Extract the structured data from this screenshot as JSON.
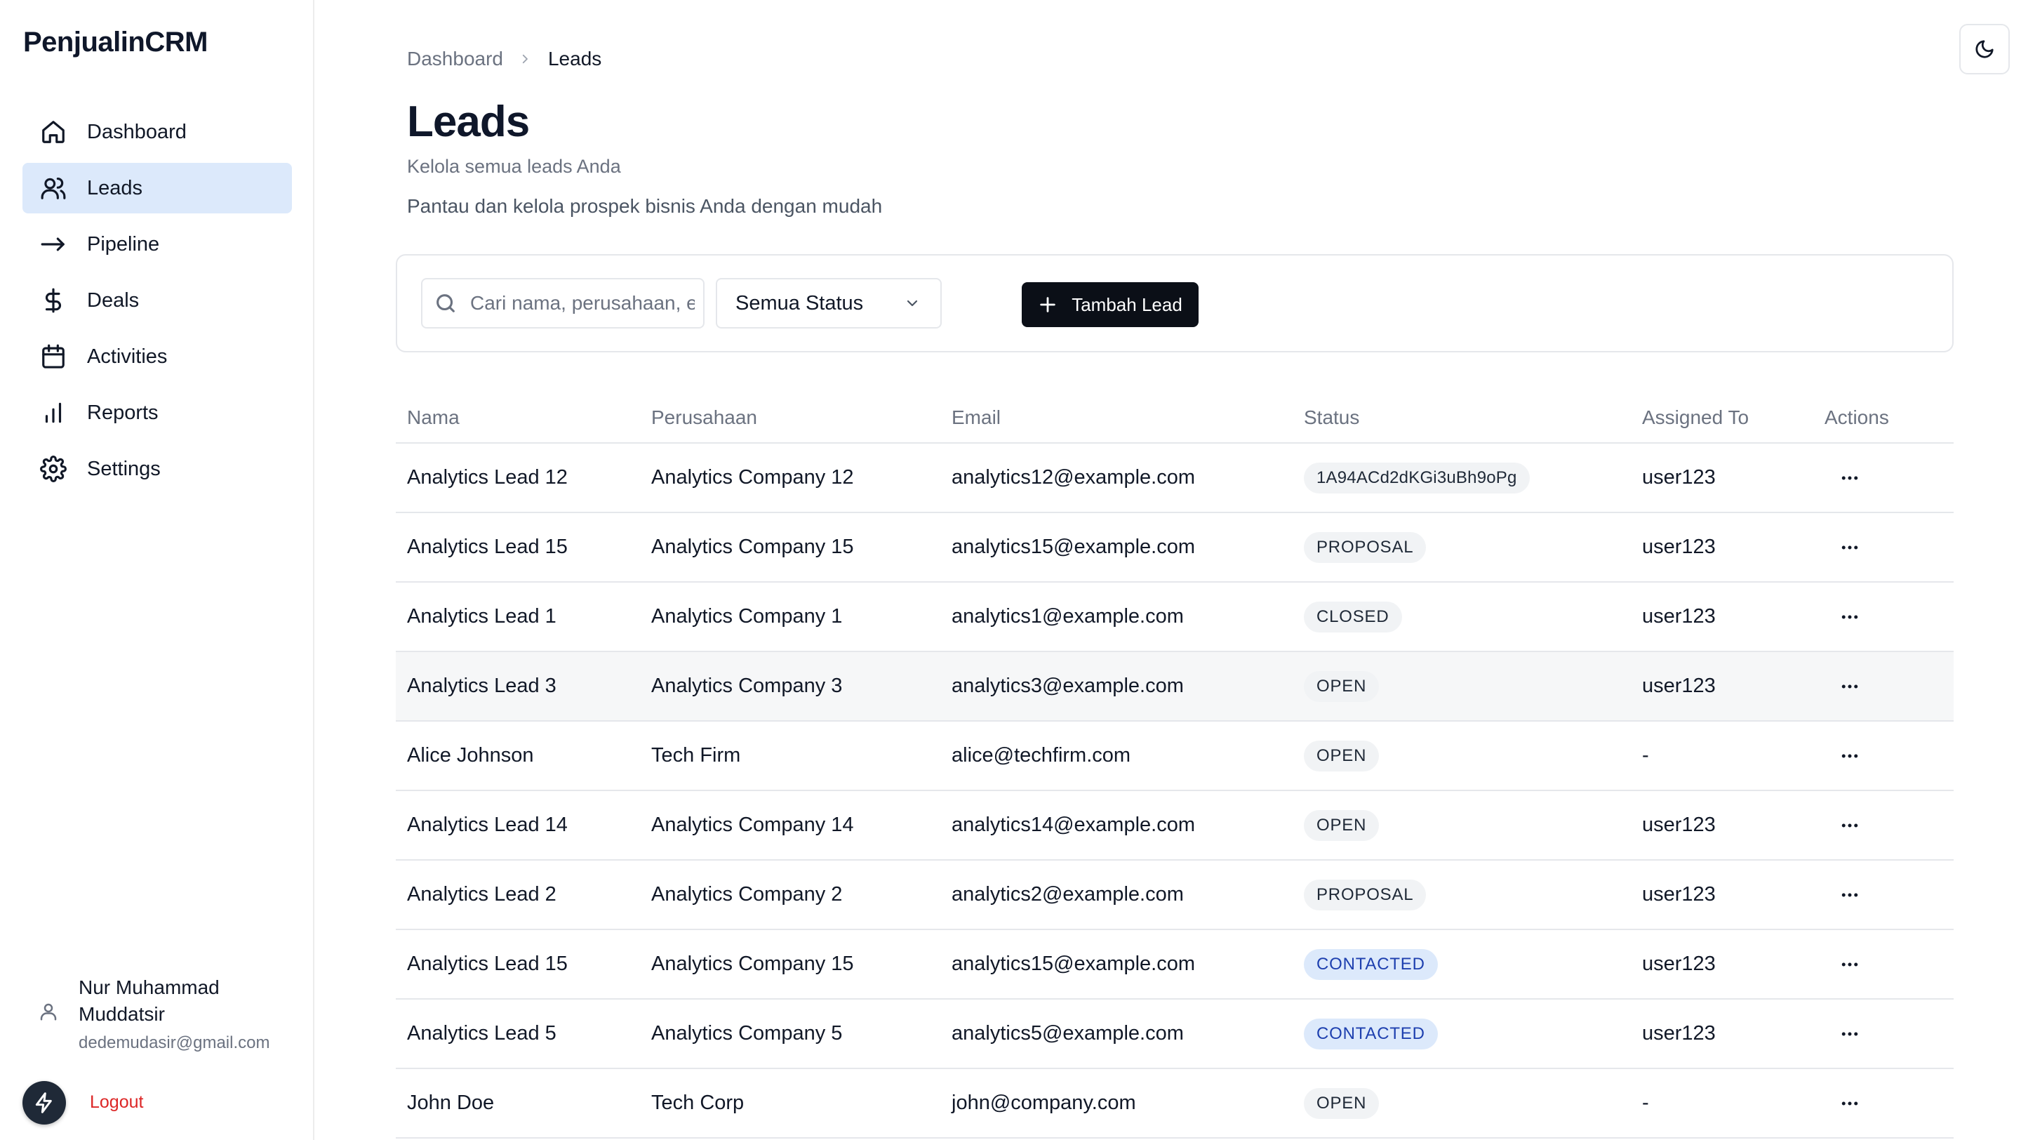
{
  "app": {
    "brand": "PenjualinCRM"
  },
  "sidebar": {
    "items": [
      {
        "label": "Dashboard",
        "icon": "home-icon",
        "active": false
      },
      {
        "label": "Leads",
        "icon": "users-icon",
        "active": true
      },
      {
        "label": "Pipeline",
        "icon": "arrow-right-icon",
        "active": false
      },
      {
        "label": "Deals",
        "icon": "dollar-icon",
        "active": false
      },
      {
        "label": "Activities",
        "icon": "calendar-icon",
        "active": false
      },
      {
        "label": "Reports",
        "icon": "bar-chart-icon",
        "active": false
      },
      {
        "label": "Settings",
        "icon": "gear-icon",
        "active": false
      }
    ],
    "user": {
      "name": "Nur Muhammad Muddatsir",
      "email": "dedemudasir@gmail.com"
    },
    "logout_label": "Logout"
  },
  "breadcrumb": {
    "root": "Dashboard",
    "current": "Leads"
  },
  "page": {
    "title": "Leads",
    "subtitle": "Kelola semua leads Anda",
    "description": "Pantau dan kelola prospek bisnis Anda dengan mudah"
  },
  "filters": {
    "search_placeholder": "Cari nama, perusahaan, email...",
    "status_value": "Semua Status",
    "add_label": "Tambah Lead"
  },
  "table": {
    "columns": [
      "Nama",
      "Perusahaan",
      "Email",
      "Status",
      "Assigned To",
      "Actions"
    ],
    "rows": [
      {
        "name": "Analytics Lead 12",
        "company": "Analytics Company 12",
        "email": "analytics12@example.com",
        "status": "1A94ACd2dKGi3uBh9oPg",
        "assigned": "user123"
      },
      {
        "name": "Analytics Lead 15",
        "company": "Analytics Company 15",
        "email": "analytics15@example.com",
        "status": "PROPOSAL",
        "assigned": "user123"
      },
      {
        "name": "Analytics Lead 1",
        "company": "Analytics Company 1",
        "email": "analytics1@example.com",
        "status": "CLOSED",
        "assigned": "user123"
      },
      {
        "name": "Analytics Lead 3",
        "company": "Analytics Company 3",
        "email": "analytics3@example.com",
        "status": "OPEN",
        "assigned": "user123"
      },
      {
        "name": "Alice Johnson",
        "company": "Tech Firm",
        "email": "alice@techfirm.com",
        "status": "OPEN",
        "assigned": "-"
      },
      {
        "name": "Analytics Lead 14",
        "company": "Analytics Company 14",
        "email": "analytics14@example.com",
        "status": "OPEN",
        "assigned": "user123"
      },
      {
        "name": "Analytics Lead 2",
        "company": "Analytics Company 2",
        "email": "analytics2@example.com",
        "status": "PROPOSAL",
        "assigned": "user123"
      },
      {
        "name": "Analytics Lead 15",
        "company": "Analytics Company 15",
        "email": "analytics15@example.com",
        "status": "CONTACTED",
        "assigned": "user123"
      },
      {
        "name": "Analytics Lead 5",
        "company": "Analytics Company 5",
        "email": "analytics5@example.com",
        "status": "CONTACTED",
        "assigned": "user123"
      },
      {
        "name": "John Doe",
        "company": "Tech Corp",
        "email": "john@company.com",
        "status": "OPEN",
        "assigned": "-"
      }
    ]
  },
  "colors": {
    "active_nav_bg": "#dce9fb",
    "contacted_badge": "#dce9fb",
    "primary_button": "#0b0f17",
    "logout": "#dc2626"
  }
}
